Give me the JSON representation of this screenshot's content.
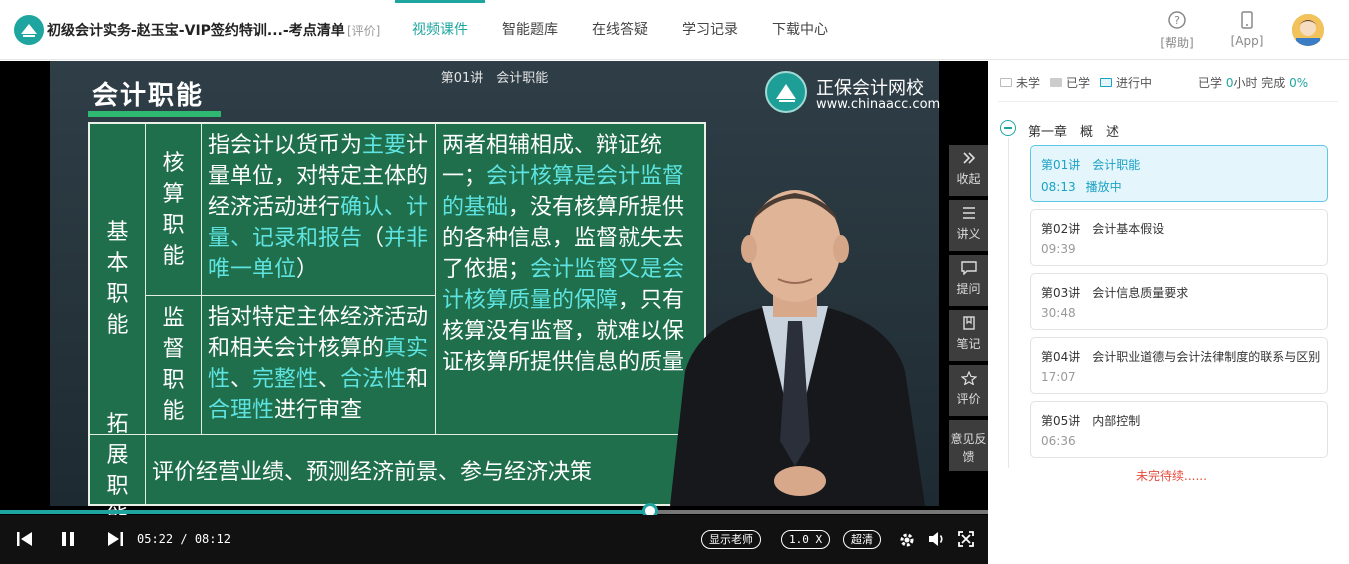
{
  "header": {
    "course_title": "初级会计实务-赵玉宝-VIP签约特训...-考点清单",
    "rate_link": "[评价]",
    "nav": [
      "视频课件",
      "智能题库",
      "在线答疑",
      "学习记录",
      "下载中心"
    ],
    "active_nav": "视频课件",
    "help_label": "[帮助]",
    "app_label": "[App]"
  },
  "video": {
    "caption": "第01讲　会计职能",
    "slide_heading": "会计职能",
    "brand_name": "正保会计网校",
    "brand_url": "www.chinaacc.com",
    "board": {
      "basic_label": "基本职能",
      "accounting_label": "核算职能",
      "supervision_label": "监督职能",
      "extended_label": "拓展职能",
      "acc_desc": [
        "指会计以货币为",
        "主要",
        "计量单位，对特定主体的经济活动进行",
        "确认、计量、记录和报告",
        "（",
        "并非唯一单位",
        "）"
      ],
      "sup_desc": [
        "指对特定主体经济活动和相关会计核算的",
        "真实性",
        "、",
        "完整性",
        "、",
        "合法性",
        "和",
        "合理性",
        "进行审查"
      ],
      "relation": [
        "两者相辅相成、辩证统一；",
        "会计核算是会计监督的基础",
        "，没有核算所提供的各种信息，监督就失去了依据；",
        "会计监督又是会计核算质量的保障",
        "，只有核算没有监督，就难以保证核算所提供信息的质量"
      ],
      "extended_desc": "评价经营业绩、预测经济前景、参与经济决策"
    },
    "progress": 0.658,
    "current_time": "05:22",
    "time_sep": " / ",
    "total_time": "08:12",
    "show_teacher": "显示老师",
    "speed": "1.0 X",
    "quality": "超清",
    "side_buttons": [
      "收起",
      "讲义",
      "提问",
      "笔记",
      "评价",
      "意见反馈"
    ],
    "colors": {
      "accent": "#1fa5a0",
      "board": "#1f6f4c",
      "highlight": "#5ee3e0"
    }
  },
  "panel": {
    "legend": [
      "未学",
      "已学",
      "进行中"
    ],
    "stats_prefix": "已学",
    "stats_hours": "0",
    "stats_mid": "小时 完成",
    "stats_percent": "0%",
    "chapter": "第一章　概　述",
    "lessons": [
      {
        "title": "第01讲　会计职能",
        "duration": "08:13",
        "status": "播放中"
      },
      {
        "title": "第02讲　会计基本假设",
        "duration": "09:39",
        "status": ""
      },
      {
        "title": "第03讲　会计信息质量要求",
        "duration": "30:48",
        "status": ""
      },
      {
        "title": "第04讲　会计职业道德与会计法律制度的联系与区别",
        "duration": "17:07",
        "status": ""
      },
      {
        "title": "第05讲　内部控制",
        "duration": "06:36",
        "status": ""
      }
    ],
    "todo": "未完待续......"
  }
}
